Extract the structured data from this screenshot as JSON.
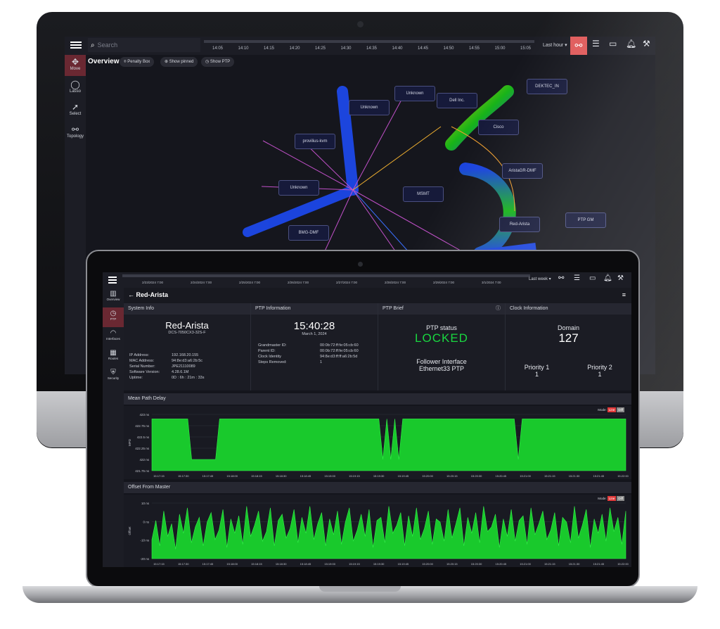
{
  "colors": {
    "accent": "#e05a5a",
    "locked": "#19d640",
    "chart_fill": "#19d22e",
    "bg": "#14151c"
  },
  "monitor": {
    "search_placeholder": "Search",
    "timeline_ticks": [
      "14:05",
      "14:10",
      "14:15",
      "14:20",
      "14:25",
      "14:30",
      "14:35",
      "14:40",
      "14:45",
      "14:50",
      "14:55",
      "15:00",
      "15:05"
    ],
    "range": "Last hour ▾",
    "sidebar": [
      {
        "label": "Move",
        "icon": "move-icon"
      },
      {
        "label": "Lasso",
        "icon": "lasso-icon"
      },
      {
        "label": "Select",
        "icon": "cursor-icon"
      },
      {
        "label": "Topology",
        "icon": "topology-icon"
      }
    ],
    "overview_title": "Overview",
    "chips": [
      "Penalty Box",
      "Show pinned",
      "Show PTP"
    ],
    "nodes": [
      "Unknown",
      "Dell Inc.",
      "DEKTEC_IN",
      "Unknown",
      "Cisco",
      "provilius-kvm",
      "AristaGR-DMF",
      "Unknown",
      "MSMT",
      "Red-Arista",
      "PTP GM",
      "BMG-DMF"
    ]
  },
  "laptop": {
    "timeline_ticks": [
      "2/23/2024 7:00",
      "2/24/2024 7:00",
      "2/25/2024 7:00",
      "2/26/2024 7:00",
      "2/27/2024 7:00",
      "2/28/2024 7:00",
      "2/29/2024 7:00",
      "3/1/2024 7:00"
    ],
    "range": "Last week ▾",
    "sidebar": [
      {
        "label": "Overview",
        "icon": "chart-icon"
      },
      {
        "label": "PTP",
        "icon": "clock-icon"
      },
      {
        "label": "Interfaces",
        "icon": "interfaces-icon"
      },
      {
        "label": "Routes",
        "icon": "grid-icon"
      },
      {
        "label": "Security",
        "icon": "shield-icon"
      }
    ],
    "device": "Red-Arista",
    "system_info": {
      "header": "System Info",
      "name": "Red-Arista",
      "model": "DCS-7050CX3-32S-F",
      "rows": [
        [
          "IP Address:",
          "192.168.20.155"
        ],
        [
          "MAC Address:",
          "94:8e:d3:a6:2b:5c"
        ],
        [
          "Serial Number:",
          "JPE21110089"
        ],
        [
          "Software Version:",
          "4.28.6.1M"
        ],
        [
          "Uptime:",
          "0D : 6h : 21m : 33s"
        ]
      ]
    },
    "ptp_info": {
      "header": "PTP Information",
      "time": "15:40:28",
      "date": "March 1, 2024",
      "rows": [
        [
          "Grandmaster ID:",
          "00:0b:72:ff:fe:05:cb:60"
        ],
        [
          "Parent ID:",
          "00:0b:72:ff:fe:05:cb:60"
        ],
        [
          "Clock Identity",
          "94:8e:d3:ff:ff:a6:2b:5d"
        ],
        [
          "Steps Removed:",
          "1"
        ]
      ]
    },
    "ptp_brief": {
      "header": "PTP Brief",
      "status_label": "PTP status",
      "status": "LOCKED",
      "follower_label": "Follower Interface",
      "follower": "Ethernet33 PTP"
    },
    "clock_info": {
      "header": "Clock Information",
      "domain_label": "Domain",
      "domain": "127",
      "p1_label": "Priority 1",
      "p1": "1",
      "p2_label": "Priority 2",
      "p2": "1"
    },
    "chart1": {
      "title": "Mean Path Delay",
      "mode": "Mode:",
      "mode_a": "Line",
      "mode_b": "Diff",
      "y_ticks": [
        "423 ns",
        "422.75 ns",
        "422.5 ns",
        "422.25 ns",
        "422 ns",
        "421.75 ns"
      ],
      "ylabel": "MPD"
    },
    "chart2": {
      "title": "Offset From Master",
      "mode": "Mode:",
      "mode_a": "Line",
      "mode_b": "Diff",
      "y_ticks": [
        "10 ns",
        "0 ns",
        "-10 ns",
        "-20 ns"
      ],
      "ylabel": "Offset"
    },
    "x_ticks": [
      "15:17:15",
      "15:17:30",
      "15:17:45",
      "15:18:00",
      "15:18:15",
      "15:18:30",
      "15:18:45",
      "15:19:00",
      "15:19:15",
      "15:19:30",
      "15:19:45",
      "15:20:00",
      "15:20:15",
      "15:20:30",
      "15:20:45",
      "15:21:00",
      "15:21:15",
      "15:21:30",
      "15:21:45",
      "15:22:00"
    ]
  },
  "chart_data": [
    {
      "type": "area",
      "title": "Mean Path Delay",
      "ylabel": "MPD",
      "ylim": [
        421.75,
        423
      ],
      "series": [
        {
          "values": [
            422.9,
            422.9,
            422.9,
            422.9,
            422.9,
            422.9,
            422.9,
            422.9,
            422.9,
            422.9,
            422.0,
            422.0,
            422.0,
            422.0,
            422.0,
            422.0,
            422.0,
            422.9,
            422.9,
            422.9,
            422.9,
            422.9,
            422.9,
            422.9,
            422.9,
            422.9,
            422.9,
            422.9,
            422.9,
            422.9,
            422.9,
            422.9,
            422.9,
            422.9,
            422.9,
            422.9,
            422.9,
            422.9,
            422.9,
            422.9,
            422.9,
            422.9,
            422.9,
            422.9,
            422.9,
            422.9,
            422.9,
            422.9,
            422.9,
            422.9,
            422.9,
            422.9,
            422.9,
            422.9,
            422.9,
            422.9,
            422.9,
            422.9,
            422.0,
            422.9,
            422.0,
            422.9,
            422.0,
            422.9,
            422.9,
            422.9,
            422.9,
            422.9,
            422.9,
            422.9,
            422.9,
            422.9,
            422.9,
            422.9,
            422.9,
            422.9,
            422.9,
            422.9,
            422.9,
            422.9,
            422.9,
            422.9,
            422.9,
            422.9,
            422.9,
            422.9,
            422.9,
            422.9,
            422.9,
            422.9,
            422.9,
            422.9,
            422.0,
            422.9,
            422.9,
            422.9,
            422.9,
            422.9,
            422.9,
            422.9,
            422.9,
            422.9,
            422.9,
            422.9,
            422.9,
            422.9,
            422.9,
            422.9,
            422.9,
            422.9,
            422.9,
            422.9,
            422.9,
            422.9,
            422.9,
            422.9,
            422.9,
            422.9,
            422.9,
            422.9
          ]
        }
      ]
    },
    {
      "type": "area",
      "title": "Offset From Master",
      "ylabel": "Offset",
      "ylim": [
        -20,
        15
      ],
      "series": [
        {
          "values": [
            -8,
            4,
            -12,
            10,
            -6,
            2,
            -14,
            8,
            -4,
            12,
            -10,
            0,
            6,
            -12,
            3,
            9,
            -8,
            -2,
            11,
            -13,
            5,
            -4,
            7,
            -11,
            13,
            -6,
            1,
            10,
            -9,
            -3,
            12,
            -12,
            4,
            8,
            -7,
            -1,
            11,
            -10,
            6,
            -4,
            13,
            -8,
            2,
            9,
            -12,
            5,
            -5,
            10,
            -11,
            3,
            12,
            -9,
            -2,
            8,
            -6,
            11,
            -13,
            4,
            6,
            -10,
            13,
            -4,
            1,
            9,
            -12,
            7,
            -6,
            12,
            -8,
            -1,
            10,
            -11,
            5,
            3,
            -9,
            11,
            -7,
            2,
            12,
            -12,
            6,
            -4,
            9,
            -10,
            13,
            -3,
            0,
            8,
            -13,
            5,
            -6,
            11,
            -9,
            4,
            7,
            -11,
            12,
            -5,
            2,
            10,
            -8,
            -2,
            9,
            -12,
            6,
            3,
            -10,
            13,
            -7,
            1,
            11,
            -13,
            5,
            -4,
            8,
            -9,
            12,
            -3,
            6,
            -11,
            10
          ]
        }
      ]
    }
  ]
}
